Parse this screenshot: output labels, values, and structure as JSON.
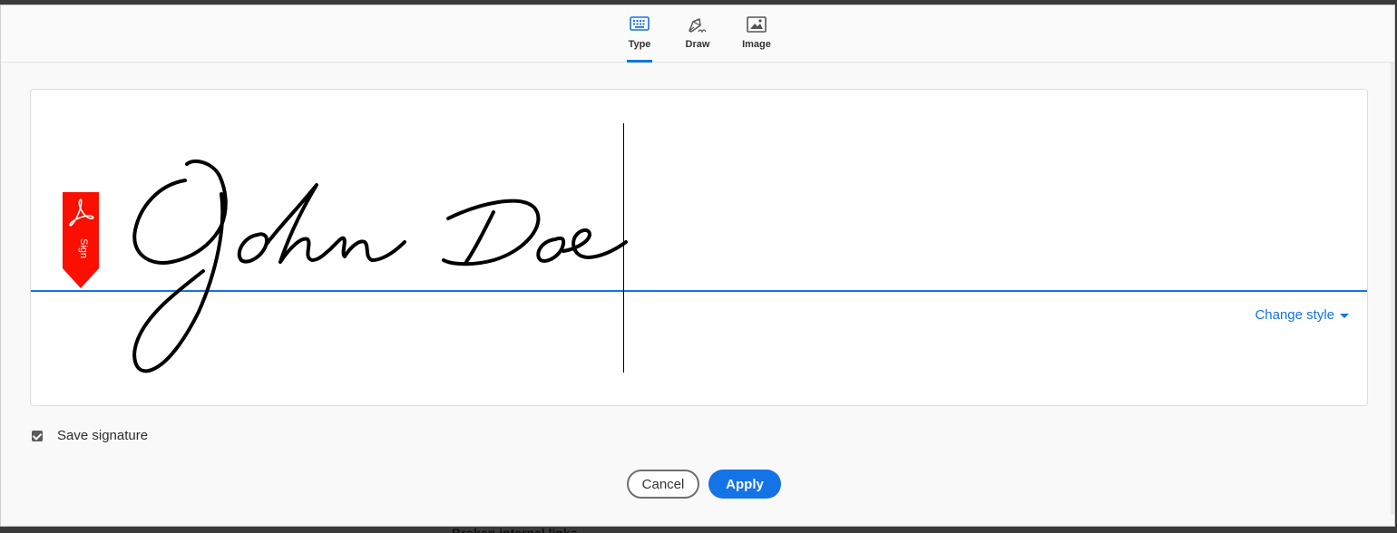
{
  "tabs": [
    {
      "label": "Type",
      "icon": "keyboard-icon",
      "active": true
    },
    {
      "label": "Draw",
      "icon": "pen-icon",
      "active": false
    },
    {
      "label": "Image",
      "icon": "image-icon",
      "active": false
    }
  ],
  "signature": {
    "text": "John Doe",
    "tag_label": "Sign"
  },
  "change_style_label": "Change style",
  "save_signature": {
    "label": "Save signature",
    "checked": true
  },
  "buttons": {
    "cancel": "Cancel",
    "apply": "Apply"
  },
  "background_peek_text": "Broken internal links",
  "colors": {
    "accent": "#1473e6",
    "tag_red": "#fa0f00"
  }
}
